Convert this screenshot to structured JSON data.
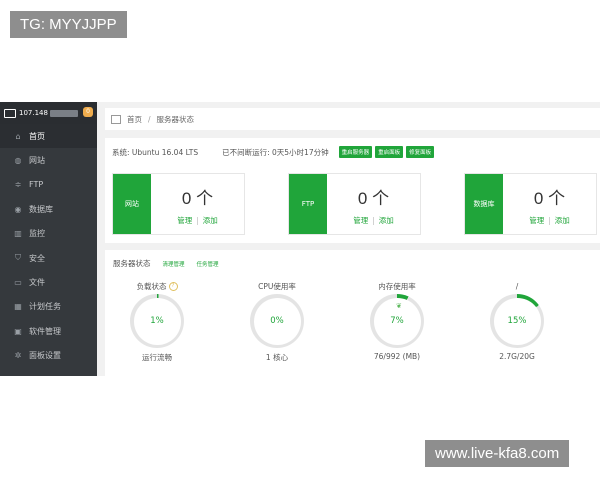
{
  "watermarks": {
    "top": "TG: MYYJJPP",
    "bottom": "www.live-kfa8.com"
  },
  "sidebar": {
    "ip": "107.148",
    "badge": "0",
    "items": [
      {
        "label": "首页",
        "icon": "home-icon",
        "active": true
      },
      {
        "label": "网站",
        "icon": "globe-icon"
      },
      {
        "label": "FTP",
        "icon": "ftp-icon"
      },
      {
        "label": "数据库",
        "icon": "database-icon"
      },
      {
        "label": "监控",
        "icon": "monitor-chart-icon"
      },
      {
        "label": "安全",
        "icon": "shield-icon"
      },
      {
        "label": "文件",
        "icon": "file-icon"
      },
      {
        "label": "计划任务",
        "icon": "calendar-icon"
      },
      {
        "label": "软件管理",
        "icon": "grid-icon"
      },
      {
        "label": "面板设置",
        "icon": "gear-icon"
      }
    ]
  },
  "breadcrumb": {
    "home": "首页",
    "current": "服务器状态"
  },
  "system": {
    "os": "系统: Ubuntu 16.04 LTS",
    "uptime": "已不间断运行: 0天5小时17分钟",
    "buttons": [
      "重启服务器",
      "重启面板",
      "修复面板"
    ]
  },
  "stats": [
    {
      "label": "网站",
      "count": "0 个",
      "manage": "管理",
      "add": "添加"
    },
    {
      "label": "FTP",
      "count": "0 个",
      "manage": "管理",
      "add": "添加"
    },
    {
      "label": "数据库",
      "count": "0 个",
      "manage": "管理",
      "add": "添加"
    }
  ],
  "status": {
    "title": "服务器状态",
    "links": [
      "清理管理",
      "任务管理"
    ],
    "gauges": [
      {
        "title": "负载状态",
        "value": "1%",
        "percent": 1,
        "sub": "运行流畅",
        "has_help": true
      },
      {
        "title": "CPU使用率",
        "value": "0%",
        "percent": 0,
        "sub": "1 核心"
      },
      {
        "title": "内存使用率",
        "value": "7%",
        "percent": 7,
        "sub": "76/992 (MB)",
        "has_leaf": true
      },
      {
        "title": "/",
        "value": "15%",
        "percent": 15,
        "sub": "2.7G/20G"
      }
    ]
  },
  "colors": {
    "accent": "#20a53a",
    "track": "#e4e4e4",
    "sidebar": "#35393d"
  }
}
